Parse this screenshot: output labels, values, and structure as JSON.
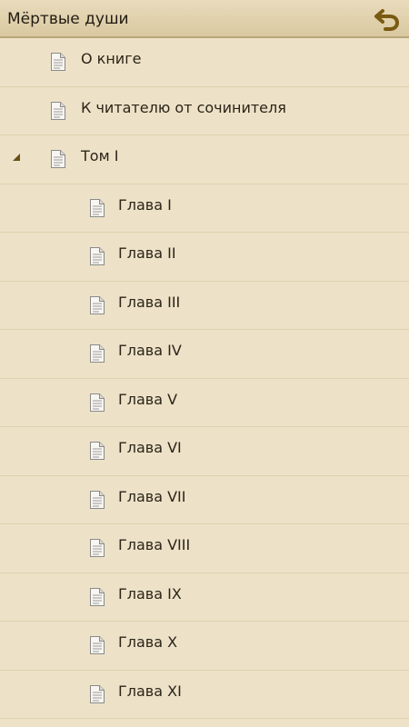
{
  "header": {
    "title": "Мёртвые души",
    "back_icon": "back-arrow-icon",
    "accent_color": "#7a5a10"
  },
  "toc": {
    "items": [
      {
        "label": "О книге",
        "level": 0,
        "expandable": false
      },
      {
        "label": "К читателю от сочинителя",
        "level": 0,
        "expandable": false
      },
      {
        "label": "Том I",
        "level": 0,
        "expandable": true,
        "expanded": true
      },
      {
        "label": "Глава I",
        "level": 1,
        "expandable": false
      },
      {
        "label": "Глава II",
        "level": 1,
        "expandable": false
      },
      {
        "label": "Глава III",
        "level": 1,
        "expandable": false
      },
      {
        "label": "Глава IV",
        "level": 1,
        "expandable": false
      },
      {
        "label": "Глава V",
        "level": 1,
        "expandable": false
      },
      {
        "label": "Глава VI",
        "level": 1,
        "expandable": false
      },
      {
        "label": "Глава VII",
        "level": 1,
        "expandable": false
      },
      {
        "label": "Глава VIII",
        "level": 1,
        "expandable": false
      },
      {
        "label": "Глава IX",
        "level": 1,
        "expandable": false
      },
      {
        "label": "Глава X",
        "level": 1,
        "expandable": false
      },
      {
        "label": "Глава XI",
        "level": 1,
        "expandable": false
      }
    ]
  }
}
